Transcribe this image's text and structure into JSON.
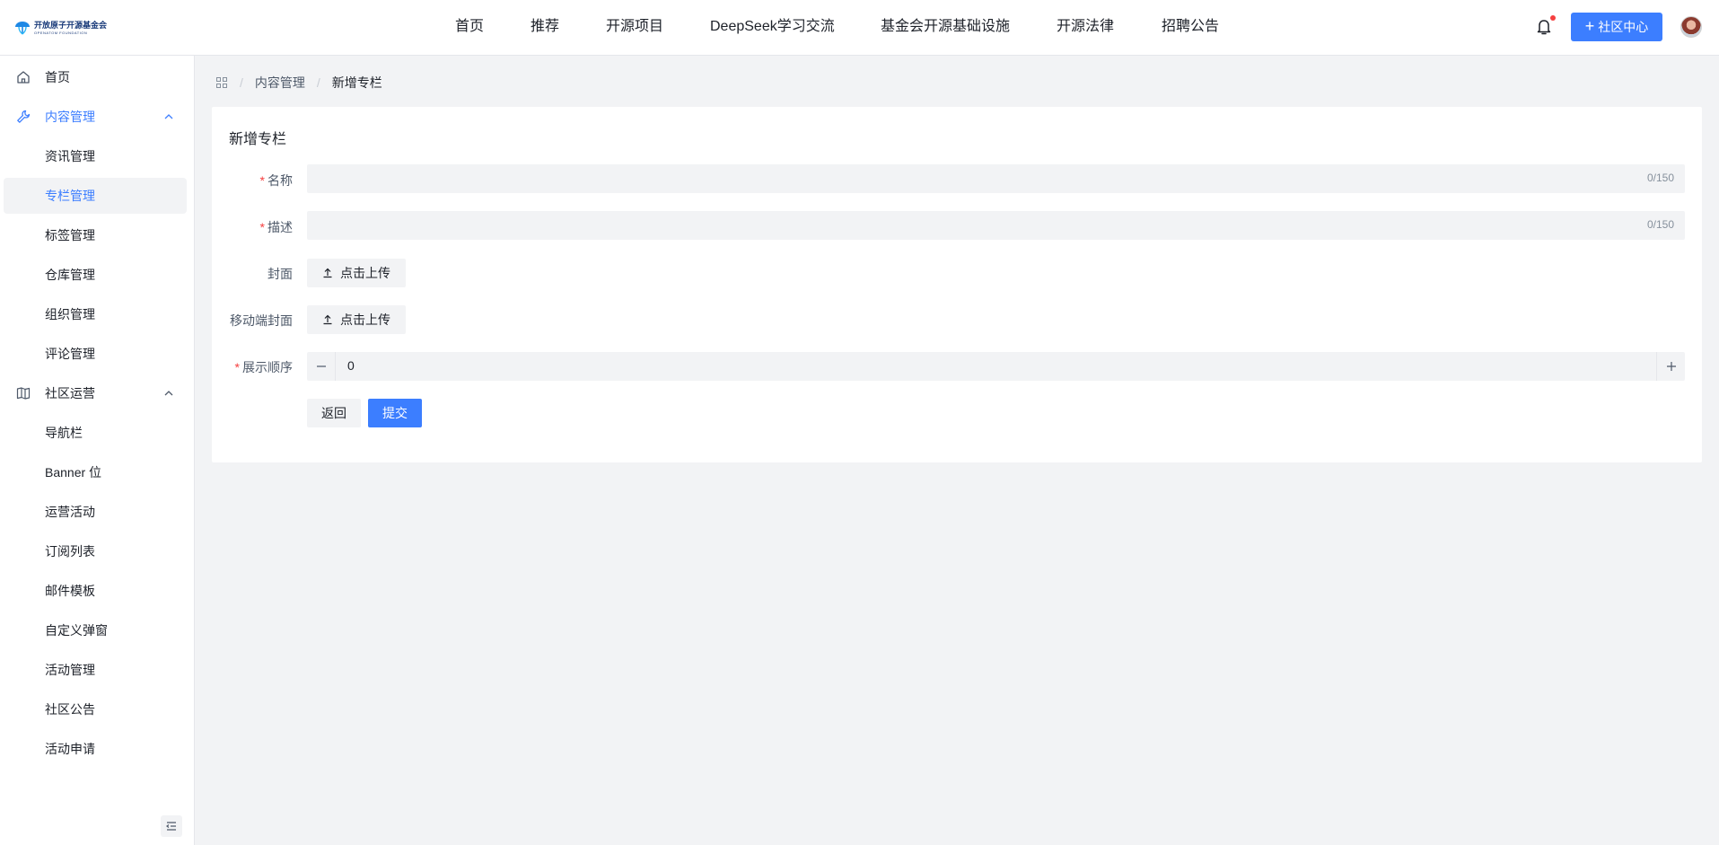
{
  "header": {
    "logo_text": "开放原子开源基金会",
    "logo_subtext": "OPENATOM FOUNDATION",
    "nav": [
      "首页",
      "推荐",
      "开源项目",
      "DeepSeek学习交流",
      "基金会开源基础设施",
      "开源法律",
      "招聘公告"
    ],
    "community_button": "社区中心",
    "notification_dot": true
  },
  "sidebar": {
    "items": [
      {
        "label": "首页",
        "icon": "home-icon"
      },
      {
        "label": "内容管理",
        "icon": "wrench-icon",
        "expanded": true
      },
      {
        "label": "资讯管理"
      },
      {
        "label": "专栏管理",
        "active": true
      },
      {
        "label": "标签管理"
      },
      {
        "label": "仓库管理"
      },
      {
        "label": "组织管理"
      },
      {
        "label": "评论管理"
      },
      {
        "label": "社区运营",
        "icon": "book-icon",
        "expanded": true
      },
      {
        "label": "导航栏"
      },
      {
        "label": "Banner 位"
      },
      {
        "label": "运营活动"
      },
      {
        "label": "订阅列表"
      },
      {
        "label": "邮件模板"
      },
      {
        "label": "自定义弹窗"
      },
      {
        "label": "活动管理"
      },
      {
        "label": "社区公告"
      },
      {
        "label": "活动申请"
      }
    ]
  },
  "breadcrumb": {
    "items": [
      "内容管理",
      "新增专栏"
    ]
  },
  "form": {
    "title": "新增专栏",
    "name_label": "名称",
    "name_value": "",
    "name_counter": "0/150",
    "desc_label": "描述",
    "desc_value": "",
    "desc_counter": "0/150",
    "cover_label": "封面",
    "cover_button": "点击上传",
    "mobile_cover_label": "移动端封面",
    "mobile_cover_button": "点击上传",
    "order_label": "展示顺序",
    "order_value": "0",
    "back_button": "返回",
    "submit_button": "提交"
  },
  "colors": {
    "primary": "#3c7eff",
    "required": "#f53f3f",
    "background": "#f2f3f5"
  }
}
